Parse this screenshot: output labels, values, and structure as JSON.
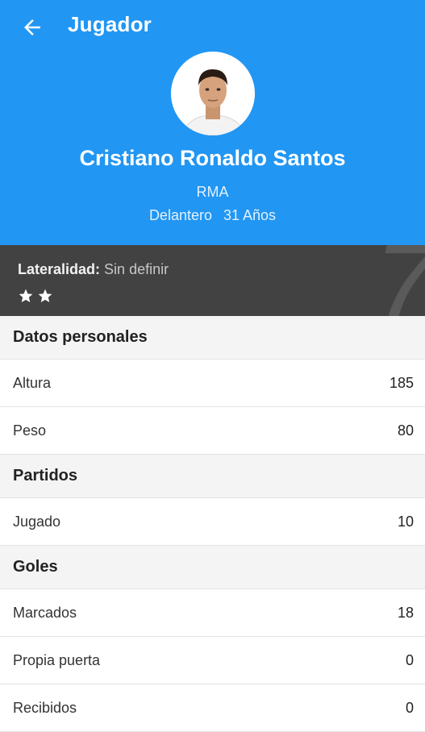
{
  "appbar": {
    "title": "Jugador"
  },
  "player": {
    "name": "Cristiano Ronaldo Santos",
    "team": "RMA",
    "position": "Delantero",
    "age": "31 Años",
    "number": "7"
  },
  "band": {
    "laterality_label": "Lateralidad:",
    "laterality_value": "Sin definir",
    "stars": 2
  },
  "sections": {
    "personal": {
      "title": "Datos personales",
      "rows": [
        {
          "label": "Altura",
          "value": "185"
        },
        {
          "label": "Peso",
          "value": "80"
        }
      ]
    },
    "matches": {
      "title": "Partidos",
      "rows": [
        {
          "label": "Jugado",
          "value": "10"
        }
      ]
    },
    "goals": {
      "title": "Goles",
      "rows": [
        {
          "label": "Marcados",
          "value": "18"
        },
        {
          "label": "Propia puerta",
          "value": "0"
        },
        {
          "label": "Recibidos",
          "value": "0"
        }
      ]
    }
  },
  "colors": {
    "primary": "#2196f3",
    "band": "#424242",
    "section_bg": "#f4f4f4"
  }
}
